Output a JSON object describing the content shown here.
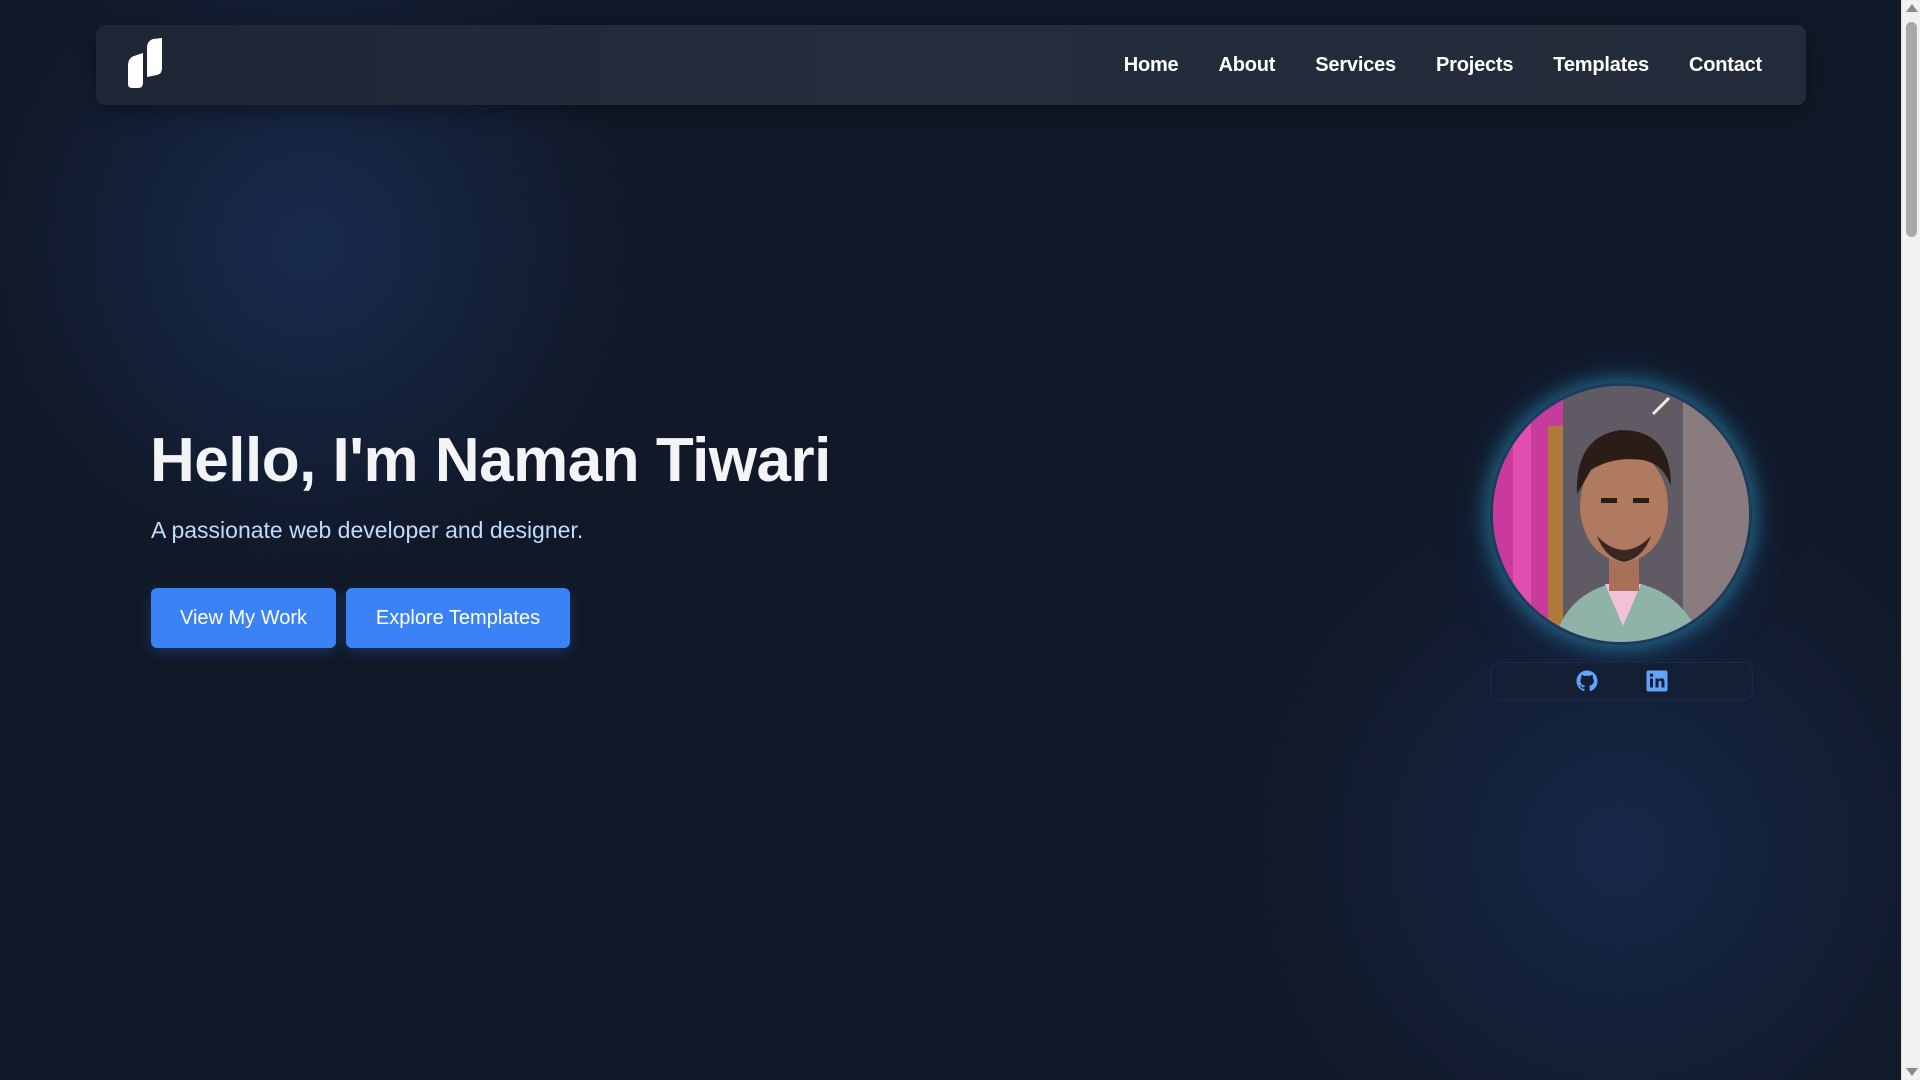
{
  "nav": {
    "logo_icon": "leaf-logo-icon",
    "links": [
      "Home",
      "About",
      "Services",
      "Projects",
      "Templates",
      "Contact"
    ]
  },
  "hero": {
    "title": "Hello, I'm Naman Tiwari",
    "subtitle": "A passionate web developer and designer.",
    "buttons": {
      "view_work": "View My Work",
      "explore_templates": "Explore Templates"
    }
  },
  "profile": {
    "photo": "profile-photo",
    "socials": [
      "github-icon",
      "linkedin-icon"
    ]
  },
  "colors": {
    "background": "#111827",
    "accent": "#3b82f6",
    "subtitle": "#bfdbfe",
    "navbar": "#232b3a"
  }
}
